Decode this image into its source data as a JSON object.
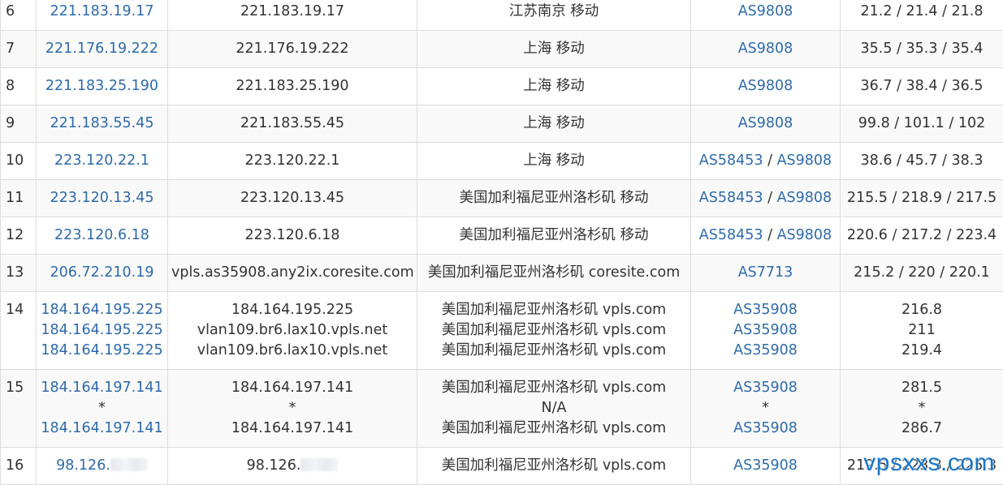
{
  "rows": [
    {
      "hop": "6",
      "ips": [
        "221.183.19.17"
      ],
      "hosts": [
        "221.183.19.17"
      ],
      "locations": [
        "江苏南京 移动"
      ],
      "asns": [
        [
          "AS9808"
        ]
      ],
      "latency": [
        "21.2 / 21.4 / 21.8"
      ]
    },
    {
      "hop": "7",
      "ips": [
        "221.176.19.222"
      ],
      "hosts": [
        "221.176.19.222"
      ],
      "locations": [
        "上海 移动"
      ],
      "asns": [
        [
          "AS9808"
        ]
      ],
      "latency": [
        "35.5 / 35.3 / 35.4"
      ]
    },
    {
      "hop": "8",
      "ips": [
        "221.183.25.190"
      ],
      "hosts": [
        "221.183.25.190"
      ],
      "locations": [
        "上海 移动"
      ],
      "asns": [
        [
          "AS9808"
        ]
      ],
      "latency": [
        "36.7 / 38.4 / 36.5"
      ]
    },
    {
      "hop": "9",
      "ips": [
        "221.183.55.45"
      ],
      "hosts": [
        "221.183.55.45"
      ],
      "locations": [
        "上海 移动"
      ],
      "asns": [
        [
          "AS9808"
        ]
      ],
      "latency": [
        "99.8 / 101.1 / 102"
      ]
    },
    {
      "hop": "10",
      "ips": [
        "223.120.22.1"
      ],
      "hosts": [
        "223.120.22.1"
      ],
      "locations": [
        "上海 移动"
      ],
      "asns": [
        [
          "AS58453",
          "AS9808"
        ]
      ],
      "latency": [
        "38.6 / 45.7 / 38.3"
      ]
    },
    {
      "hop": "11",
      "ips": [
        "223.120.13.45"
      ],
      "hosts": [
        "223.120.13.45"
      ],
      "locations": [
        "美国加利福尼亚州洛杉矶 移动"
      ],
      "asns": [
        [
          "AS58453",
          "AS9808"
        ]
      ],
      "latency": [
        "215.5 / 218.9 / 217.5"
      ]
    },
    {
      "hop": "12",
      "ips": [
        "223.120.6.18"
      ],
      "hosts": [
        "223.120.6.18"
      ],
      "locations": [
        "美国加利福尼亚州洛杉矶 移动"
      ],
      "asns": [
        [
          "AS58453",
          "AS9808"
        ]
      ],
      "latency": [
        "220.6 / 217.2 / 223.4"
      ]
    },
    {
      "hop": "13",
      "ips": [
        "206.72.210.19"
      ],
      "hosts": [
        "vpls.as35908.any2ix.coresite.com"
      ],
      "locations": [
        "美国加利福尼亚州洛杉矶 coresite.com"
      ],
      "asns": [
        [
          "AS7713"
        ]
      ],
      "latency": [
        "215.2 / 220 / 220.1"
      ]
    },
    {
      "hop": "14",
      "ips": [
        "184.164.195.225",
        "184.164.195.225",
        "184.164.195.225"
      ],
      "hosts": [
        "184.164.195.225",
        "vlan109.br6.lax10.vpls.net",
        "vlan109.br6.lax10.vpls.net"
      ],
      "locations": [
        "美国加利福尼亚州洛杉矶 vpls.com",
        "美国加利福尼亚州洛杉矶 vpls.com",
        "美国加利福尼亚州洛杉矶 vpls.com"
      ],
      "asns": [
        [
          "AS35908"
        ],
        [
          "AS35908"
        ],
        [
          "AS35908"
        ]
      ],
      "latency": [
        "216.8",
        "211",
        "219.4"
      ]
    },
    {
      "hop": "15",
      "ips": [
        "184.164.197.141",
        "*",
        "184.164.197.141"
      ],
      "hosts": [
        "184.164.197.141",
        "*",
        "184.164.197.141"
      ],
      "locations": [
        "美国加利福尼亚州洛杉矶 vpls.com",
        "N/A",
        "美国加利福尼亚州洛杉矶 vpls.com"
      ],
      "asns": [
        [
          "AS35908"
        ],
        [
          "*"
        ],
        [
          "AS35908"
        ]
      ],
      "latency": [
        "281.5",
        "*",
        "286.7"
      ]
    },
    {
      "hop": "16",
      "ips": [
        "98.126."
      ],
      "hosts": [
        "98.126."
      ],
      "locations": [
        "美国加利福尼亚州洛杉矶 vpls.com"
      ],
      "asns": [
        [
          "AS35908"
        ]
      ],
      "latency": [
        "219.5 / 223.3 / 225.3"
      ],
      "blurred": true
    }
  ],
  "watermark": "vpsxxs.com",
  "colors": {
    "link": "#2f6aa8",
    "text": "#333333",
    "border": "#dddddd",
    "zebra": "#f9f9f9",
    "watermark": "#1976c8"
  }
}
